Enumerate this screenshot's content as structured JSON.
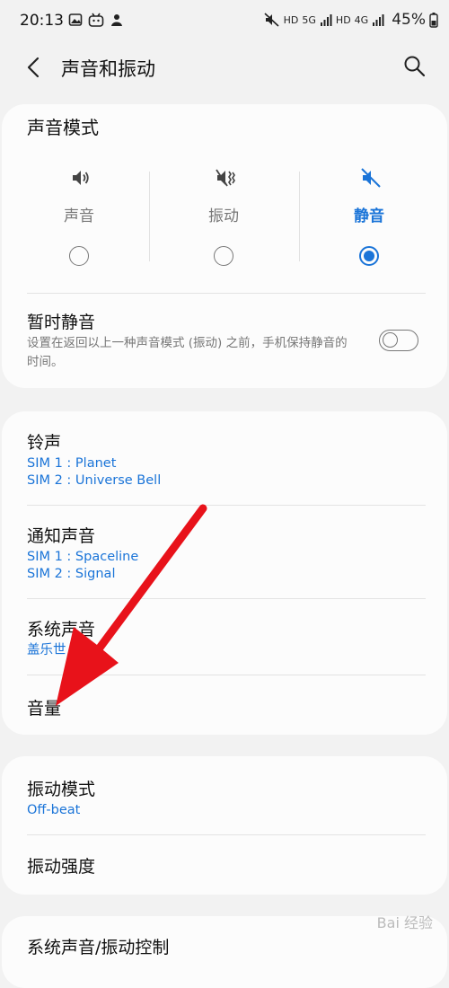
{
  "status_bar": {
    "time": "20:13",
    "hd1": "HD",
    "net1": "5G",
    "hd2": "HD",
    "net2": "4G",
    "battery": "45%",
    "left_icons": [
      "gallery-icon",
      "bilibili-icon",
      "person-icon"
    ],
    "right_icons": [
      "mute-icon",
      "signal-icon",
      "battery-icon"
    ]
  },
  "header": {
    "title": "声音和振动",
    "back_icon": "back-arrow-icon",
    "search_icon": "search-icon"
  },
  "sound_mode": {
    "title": "声音模式",
    "options": [
      {
        "label": "声音",
        "icon": "speaker-icon",
        "selected": false
      },
      {
        "label": "振动",
        "icon": "vibrate-icon",
        "selected": false
      },
      {
        "label": "静音",
        "icon": "mute-icon",
        "selected": true
      }
    ],
    "temp_mute": {
      "title": "暂时静音",
      "desc": "设置在返回以上一种声音模式 (振动) 之前，手机保持静音的时间。",
      "enabled": false
    }
  },
  "sounds": {
    "ringtone": {
      "title": "铃声",
      "sim1": "SIM 1 : Planet",
      "sim2": "SIM 2 : Universe Bell"
    },
    "notification": {
      "title": "通知声音",
      "sim1": "SIM 1 : Spaceline",
      "sim2": "SIM 2 : Signal"
    },
    "system": {
      "title": "系统声音",
      "sub": "盖乐世"
    },
    "volume": {
      "title": "音量"
    }
  },
  "vibration": {
    "pattern": {
      "title": "振动模式",
      "sub": "Off-beat"
    },
    "intensity": {
      "title": "振动强度"
    }
  },
  "partial": {
    "title": "系统声音/振动控制"
  },
  "watermark": "Bai 经验",
  "colors": {
    "accent": "#1a74d8",
    "arrow": "#e8121a",
    "background": "#f2f2f2",
    "card": "#fcfcfc"
  }
}
